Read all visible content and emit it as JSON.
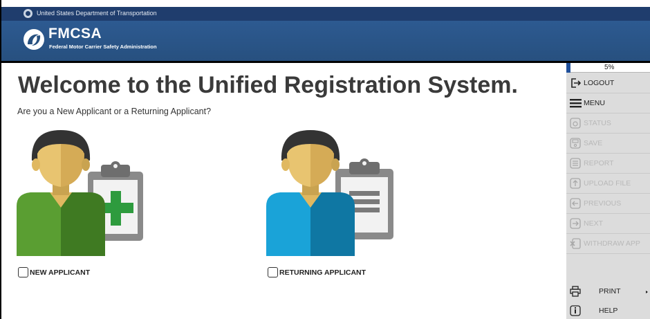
{
  "dot_banner": {
    "text": "United States Department of Transportation"
  },
  "brand": {
    "acronym": "FMCSA",
    "full_name": "Federal Motor Carrier Safety Administration"
  },
  "main": {
    "title": "Welcome to the Unified Registration System.",
    "subtitle": "Are you a New Applicant or a Returning Applicant?",
    "new_applicant": {
      "label": "NEW APPLICANT",
      "checked": false,
      "icon": "person-clipboard-plus-icon",
      "shirt_color": "#5a9e32"
    },
    "returning_applicant": {
      "label": "RETURNING APPLICANT",
      "checked": false,
      "icon": "person-clipboard-lines-icon",
      "shirt_color": "#1aa3d8"
    }
  },
  "sidebar": {
    "progress": {
      "percent": 5,
      "label": "5%",
      "color": "#1f4f9a"
    },
    "items": [
      {
        "label": "LOGOUT",
        "icon": "logout-icon",
        "enabled": true
      },
      {
        "label": "MENU",
        "icon": "menu-icon",
        "enabled": true
      },
      {
        "label": "STATUS",
        "icon": "status-icon",
        "enabled": false
      },
      {
        "label": "SAVE",
        "icon": "save-icon",
        "enabled": false
      },
      {
        "label": "REPORT",
        "icon": "report-icon",
        "enabled": false
      },
      {
        "label": "UPLOAD FILE",
        "icon": "upload-icon",
        "enabled": false
      },
      {
        "label": "PREVIOUS",
        "icon": "previous-icon",
        "enabled": false
      },
      {
        "label": "NEXT",
        "icon": "next-icon",
        "enabled": false
      },
      {
        "label": "WITHDRAW APP",
        "icon": "withdraw-icon",
        "enabled": false
      }
    ],
    "print_label": "PRINT",
    "help_label": "HELP"
  },
  "colors": {
    "dot_bar": "#1f3d6d",
    "brand_bar": "#2d5a91",
    "sidebar_bg": "#dcdcdc"
  }
}
